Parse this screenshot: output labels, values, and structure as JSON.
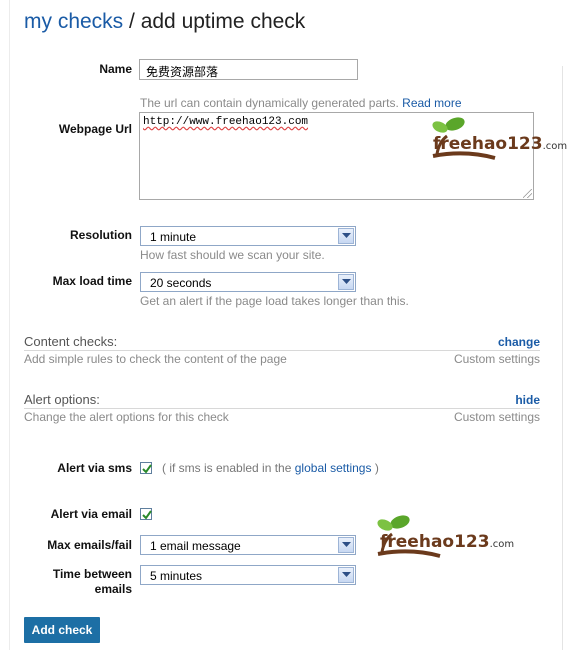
{
  "header": {
    "breadcrumb_link": "my checks",
    "separator": " / ",
    "title": "add uptime check"
  },
  "form": {
    "name": {
      "label": "Name",
      "value": "免费资源部落"
    },
    "url": {
      "hint": "The url can contain dynamically generated parts.",
      "hint_link": "Read more",
      "label": "Webpage Url",
      "value": "http://www.freehao123.com"
    },
    "resolution": {
      "label": "Resolution",
      "value": "1 minute",
      "hint": "How fast should we scan your site."
    },
    "max_load_time": {
      "label": "Max load time",
      "value": "20 seconds",
      "hint": "Get an alert if the page load takes longer than this."
    }
  },
  "content_checks": {
    "title": "Content checks:",
    "action": "change",
    "description": "Add simple rules to check the content of the page",
    "status": "Custom settings"
  },
  "alert_options": {
    "title": "Alert options:",
    "action": "hide",
    "description": "Change the alert options for this check",
    "status": "Custom settings"
  },
  "alerts": {
    "sms": {
      "label": "Alert via sms",
      "checked": true,
      "note_prefix": "( if sms is enabled in the",
      "note_link": "global settings",
      "note_suffix": ")"
    },
    "email": {
      "label": "Alert via email",
      "checked": true
    },
    "max_emails": {
      "label": "Max emails/fail",
      "value": "1 email message"
    },
    "time_between": {
      "label_line1": "Time between",
      "label_line2": "emails",
      "value": "5 minutes"
    }
  },
  "submit": {
    "label": "Add check"
  },
  "watermark": {
    "text": "freehao123",
    "suffix": ".com"
  },
  "colors": {
    "accent": "#1a5ba6",
    "button": "#1d6fa5",
    "hint": "#8a8a8a",
    "logo_brown": "#6b3a1c",
    "logo_green": "#5aa62a"
  }
}
